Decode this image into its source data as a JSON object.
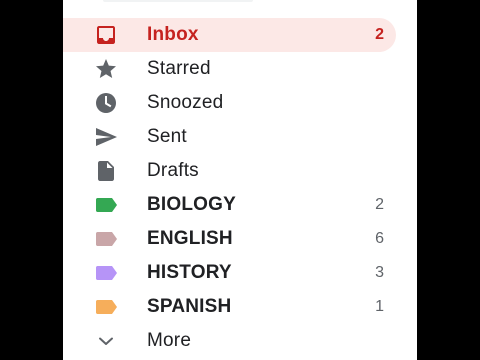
{
  "nav": {
    "items": [
      {
        "label": "Inbox",
        "count": "2",
        "icon": "inbox-icon"
      },
      {
        "label": "Starred",
        "count": "",
        "icon": "star-icon"
      },
      {
        "label": "Snoozed",
        "count": "",
        "icon": "clock-icon"
      },
      {
        "label": "Sent",
        "count": "",
        "icon": "send-icon"
      },
      {
        "label": "Drafts",
        "count": "",
        "icon": "draft-icon"
      }
    ],
    "labels": [
      {
        "label": "BIOLOGY",
        "count": "2",
        "color": "#34a853"
      },
      {
        "label": "ENGLISH",
        "count": "6",
        "color": "#c9a6a8"
      },
      {
        "label": "HISTORY",
        "count": "3",
        "color": "#b694f7"
      },
      {
        "label": "SPANISH",
        "count": "1",
        "color": "#f6ae5b"
      }
    ],
    "more_label": "More"
  },
  "colors": {
    "active_bg": "#fce8e6",
    "active_text": "#c5221f",
    "icon_gray": "#5f6368"
  }
}
